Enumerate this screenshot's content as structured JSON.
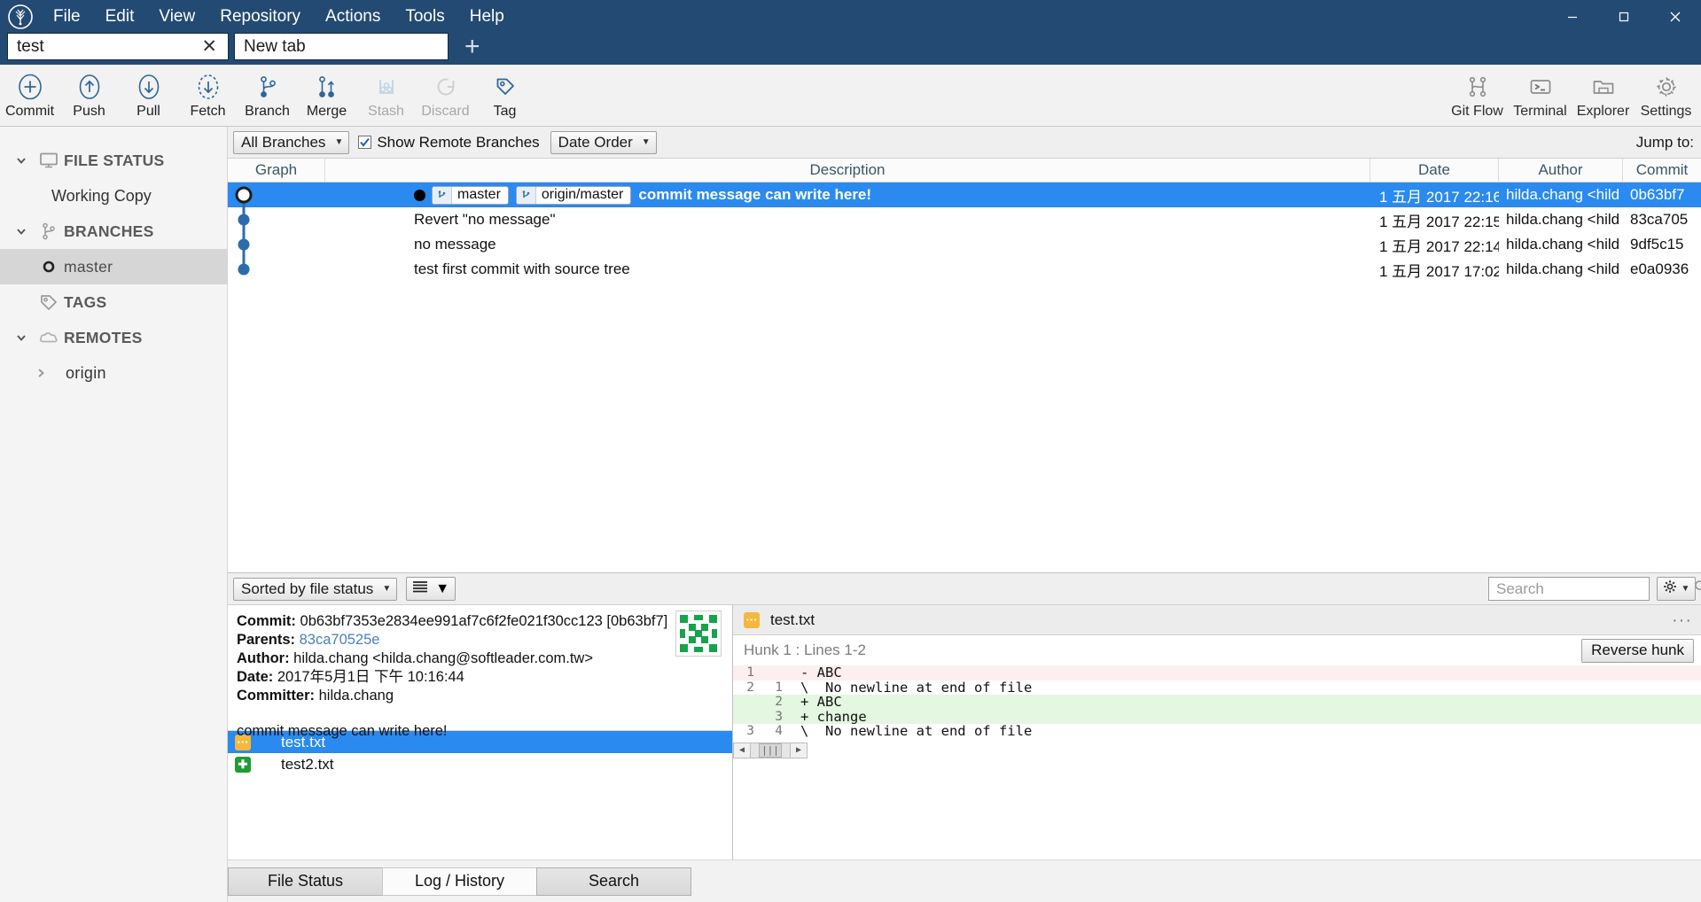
{
  "window": {
    "menus": [
      "File",
      "Edit",
      "View",
      "Repository",
      "Actions",
      "Tools",
      "Help"
    ],
    "controls": {
      "minimize": "minimize-icon",
      "maximize": "maximize-icon",
      "close": "close-icon"
    }
  },
  "tabs": {
    "repo_tab": "test",
    "new_tab": "New tab",
    "add_label": "+",
    "close_label": "✕"
  },
  "toolbar": {
    "left": [
      {
        "label": "Commit",
        "icon": "commit-plus-icon",
        "disabled": false
      },
      {
        "label": "Push",
        "icon": "push-up-arrow-icon",
        "disabled": false
      },
      {
        "label": "Pull",
        "icon": "pull-down-arrow-icon",
        "disabled": false
      },
      {
        "label": "Fetch",
        "icon": "fetch-dashed-arrow-icon",
        "disabled": false
      },
      {
        "label": "Branch",
        "icon": "branch-icon",
        "disabled": false
      },
      {
        "label": "Merge",
        "icon": "merge-icon",
        "disabled": false
      },
      {
        "label": "Stash",
        "icon": "stash-icon",
        "disabled": true
      },
      {
        "label": "Discard",
        "icon": "discard-circle-icon",
        "disabled": true
      },
      {
        "label": "Tag",
        "icon": "tag-icon",
        "disabled": false
      }
    ],
    "right": [
      {
        "label": "Git Flow",
        "icon": "git-flow-icon"
      },
      {
        "label": "Terminal",
        "icon": "terminal-icon"
      },
      {
        "label": "Explorer",
        "icon": "folder-icon"
      },
      {
        "label": "Settings",
        "icon": "gear-icon"
      }
    ]
  },
  "sidebar": {
    "sections": [
      {
        "label": "FILE STATUS",
        "icon": "monitor-icon",
        "expanded": true
      },
      {
        "label": "Working Copy",
        "type": "child"
      },
      {
        "label": "BRANCHES",
        "icon": "branch-icon",
        "expanded": true
      },
      {
        "label": "master",
        "type": "branch",
        "icon": "branch-dot-icon",
        "selected": true
      },
      {
        "label": "TAGS",
        "icon": "tag-icon",
        "expanded": false
      },
      {
        "label": "REMOTES",
        "icon": "cloud-icon",
        "expanded": true
      },
      {
        "label": "origin",
        "type": "remote-child",
        "icon": "chevron-right-icon"
      }
    ]
  },
  "logbar": {
    "branch_filter": "All Branches",
    "show_remote_label": "Show Remote Branches",
    "show_remote_checked": true,
    "order": "Date Order",
    "jump_to": "Jump to:"
  },
  "commit_table": {
    "columns": [
      "Graph",
      "Description",
      "Date",
      "Author",
      "Commit"
    ],
    "rows": [
      {
        "message": "commit message can write here!",
        "refs": [
          "master",
          "origin/master"
        ],
        "date": "1 五月 2017 22:16",
        "author": "hilda.chang <hild",
        "commit": "0b63bf7",
        "selected": true
      },
      {
        "message": "Revert \"no message\"",
        "refs": [],
        "date": "1 五月 2017 22:15",
        "author": "hilda.chang <hild",
        "commit": "83ca705",
        "selected": false
      },
      {
        "message": "no message",
        "refs": [],
        "date": "1 五月 2017 22:14",
        "author": "hilda.chang <hild",
        "commit": "9df5c15",
        "selected": false
      },
      {
        "message": "test first commit with source tree",
        "refs": [],
        "date": "1 五月 2017 17:02",
        "author": "hilda.chang <hild",
        "commit": "e0a0936",
        "selected": false
      }
    ]
  },
  "lowerbar": {
    "sort": "Sorted by file status",
    "view_icon": "list-view-icon",
    "search_placeholder": "Search",
    "search_value": "",
    "gear_icon": "gear-icon"
  },
  "commit_details": {
    "commit_label": "Commit:",
    "commit_value": "0b63bf7353e2834ee991af7c6f2fe021f30cc123 [0b63bf7]",
    "parents_label": "Parents:",
    "parents_value": "83ca70525e",
    "author_label": "Author:",
    "author_value": "hilda.chang <hilda.chang@softleader.com.tw>",
    "date_label": "Date:",
    "date_value": "2017年5月1日 下午 10:16:44",
    "committer_label": "Committer:",
    "committer_value": "hilda.chang",
    "message": "commit message can write here!"
  },
  "file_list": [
    {
      "name": "test.txt",
      "status": "modified",
      "selected": true
    },
    {
      "name": "test2.txt",
      "status": "added",
      "selected": false
    }
  ],
  "diff": {
    "file_name": "test.txt",
    "file_status_icon": "modified-file-icon",
    "more_icon": "more-dots-icon",
    "hunk_label": "Hunk 1 : Lines 1-2",
    "reverse_button": "Reverse hunk",
    "lines": [
      {
        "old": "1",
        "new": "",
        "text": "- ABC",
        "type": "rem"
      },
      {
        "old": "2",
        "new": "1",
        "text": "\\  No newline at end of file",
        "type": "ctx"
      },
      {
        "old": "",
        "new": "2",
        "text": "+ ABC",
        "type": "add"
      },
      {
        "old": "",
        "new": "3",
        "text": "+ change",
        "type": "add"
      },
      {
        "old": "3",
        "new": "4",
        "text": "\\  No newline at end of file",
        "type": "ctx"
      }
    ]
  },
  "bottom_tabs": [
    {
      "label": "File Status",
      "active": false
    },
    {
      "label": "Log / History",
      "active": true
    },
    {
      "label": "Search",
      "active": false
    }
  ],
  "colors": {
    "titlebar": "#234a72",
    "selection": "#2a8aef",
    "graph_node": "#2b6cb0",
    "add_bg": "#e4f7e1",
    "rem_bg": "#fdeef0"
  }
}
